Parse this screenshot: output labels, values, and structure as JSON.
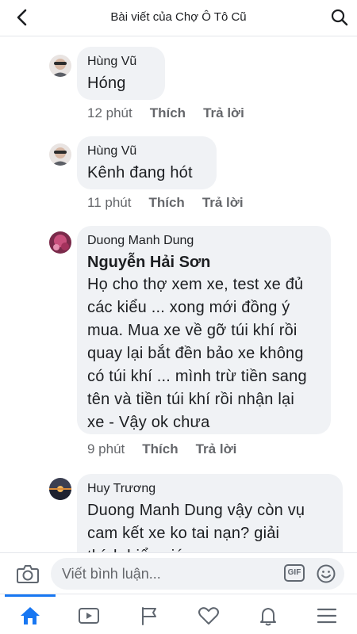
{
  "header": {
    "title": "Bài viết của Chợ Ô Tô Cũ"
  },
  "comments": [
    {
      "author": "Hùng Vũ",
      "text": "Hóng",
      "time": "12 phút",
      "like": "Thích",
      "reply": "Trả lời"
    },
    {
      "author": "Hùng Vũ",
      "text": "Kênh đang hót",
      "time": "11 phút",
      "like": "Thích",
      "reply": "Trả lời"
    },
    {
      "author": "Duong Manh Dung",
      "tag": "Nguyễn Hải Sơn",
      "lines": [
        "Họ cho thợ xem xe, test xe đủ",
        "các kiểu ... xong mới đồng ý",
        "mua. Mua xe về gỡ túi khí rồi",
        "quay lại bắt đền bảo xe không",
        "có túi khí ... mình trừ tiền sang",
        "tên và tiền túi khí rồi nhận lại",
        "xe  - Vậy ok chưa"
      ],
      "time": "9 phút",
      "like": "Thích",
      "reply": "Trả lời"
    },
    {
      "author": "Huy Trương",
      "lines": [
        "Duong Manh Dung vậy còn vụ",
        "cam kết xe ko tai nạn? giải",
        "thích hiểu giúp"
      ]
    }
  ],
  "composer": {
    "placeholder": "Viết bình luận...",
    "gif": "GIF"
  },
  "tabbar": {
    "items": [
      "home-icon",
      "video-icon",
      "flag-icon",
      "heart-icon",
      "bell-icon",
      "menu-icon"
    ],
    "active": "home-icon",
    "accent": "#1877f2"
  }
}
